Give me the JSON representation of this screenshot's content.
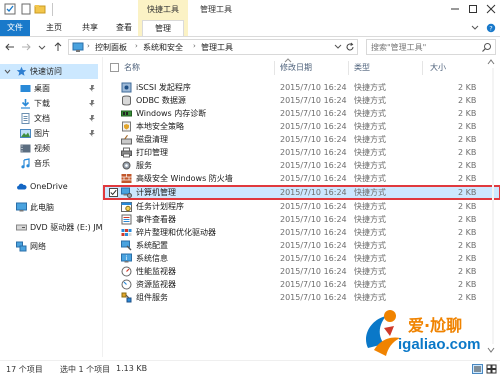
{
  "window": {
    "title": "管理工具",
    "context_tab_group": "快捷工具"
  },
  "ribbon": {
    "tabs": [
      {
        "label": "文件"
      },
      {
        "label": "主页"
      },
      {
        "label": "共享"
      },
      {
        "label": "查看"
      },
      {
        "label": "管理"
      }
    ]
  },
  "address": {
    "crumbs": [
      "控制面板",
      "系统和安全",
      "管理工具"
    ],
    "search_placeholder": "搜索\"管理工具\""
  },
  "nav": {
    "items": [
      {
        "label": "快速访问",
        "icon": "star-icon"
      },
      {
        "label": "桌面",
        "icon": "desktop-icon",
        "pinned": true
      },
      {
        "label": "下载",
        "icon": "download-icon",
        "pinned": true
      },
      {
        "label": "文档",
        "icon": "document-icon",
        "pinned": true
      },
      {
        "label": "图片",
        "icon": "pictures-icon",
        "pinned": true
      },
      {
        "label": "视频",
        "icon": "video-icon"
      },
      {
        "label": "音乐",
        "icon": "music-icon"
      },
      {
        "label": "OneDrive",
        "icon": "cloud-icon"
      },
      {
        "label": "此电脑",
        "icon": "computer-icon"
      },
      {
        "label": "DVD 驱动器 (E:) JM",
        "icon": "dvd-icon"
      },
      {
        "label": "网络",
        "icon": "network-icon"
      }
    ]
  },
  "list": {
    "columns": {
      "name": "名称",
      "modified": "修改日期",
      "type": "类型",
      "size": "大小"
    },
    "rows": [
      {
        "name": "iSCSI 发起程序",
        "modified": "2015/7/10 16:24",
        "type": "快捷方式",
        "size": "2 KB"
      },
      {
        "name": "ODBC 数据源",
        "modified": "2015/7/10 16:24",
        "type": "快捷方式",
        "size": "2 KB"
      },
      {
        "name": "Windows 内存诊断",
        "modified": "2015/7/10 16:24",
        "type": "快捷方式",
        "size": "2 KB"
      },
      {
        "name": "本地安全策略",
        "modified": "2015/7/10 16:24",
        "type": "快捷方式",
        "size": "2 KB"
      },
      {
        "name": "磁盘清理",
        "modified": "2015/7/10 16:24",
        "type": "快捷方式",
        "size": "2 KB"
      },
      {
        "name": "打印管理",
        "modified": "2015/7/10 16:24",
        "type": "快捷方式",
        "size": "2 KB"
      },
      {
        "name": "服务",
        "modified": "2015/7/10 16:24",
        "type": "快捷方式",
        "size": "2 KB"
      },
      {
        "name": "高级安全 Windows 防火墙",
        "modified": "2015/7/10 16:24",
        "type": "快捷方式",
        "size": "2 KB"
      },
      {
        "name": "计算机管理",
        "modified": "2015/7/10 16:24",
        "type": "快捷方式",
        "size": "2 KB",
        "selected": true
      },
      {
        "name": "任务计划程序",
        "modified": "2015/7/10 16:24",
        "type": "快捷方式",
        "size": "2 KB"
      },
      {
        "name": "事件查看器",
        "modified": "2015/7/10 16:24",
        "type": "快捷方式",
        "size": "2 KB"
      },
      {
        "name": "碎片整理和优化驱动器",
        "modified": "2015/7/10 16:24",
        "type": "快捷方式",
        "size": "2 KB"
      },
      {
        "name": "系统配置",
        "modified": "2015/7/10 16:24",
        "type": "快捷方式",
        "size": "2 KB"
      },
      {
        "name": "系统信息",
        "modified": "2015/7/10 16:24",
        "type": "快捷方式",
        "size": "2 KB"
      },
      {
        "name": "性能监视器",
        "modified": "2015/7/10 16:24",
        "type": "快捷方式",
        "size": "2 KB"
      },
      {
        "name": "资源监视器",
        "modified": "2015/7/10 16:24",
        "type": "快捷方式",
        "size": "2 KB"
      },
      {
        "name": "组件服务",
        "modified": "2015/7/10 16:24",
        "type": "快捷方式",
        "size": "2 KB"
      }
    ]
  },
  "status": {
    "item_count": "17 个项目",
    "selected": "选中 1 个项目",
    "selected_size": "1.13 KB"
  },
  "watermark": {
    "brand": "爱·尬聊",
    "url": "igaliao.com"
  },
  "colors": {
    "file_tab": "#1979ca",
    "context_tab": "#fbf2c5",
    "selection": "#cde8ff",
    "highlight_border": "#e0393e",
    "watermark_orange": "#f08300",
    "watermark_blue": "#0a78c8"
  }
}
